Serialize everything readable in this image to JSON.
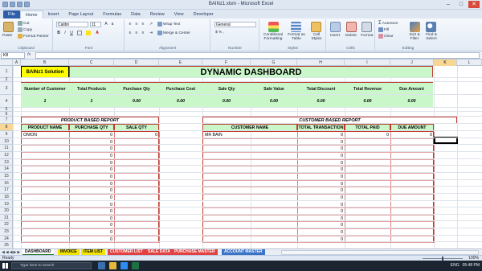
{
  "window": {
    "title": "BAINz1.xlsm  -  Microsoft Excel"
  },
  "tabs": [
    "File",
    "Home",
    "Insert",
    "Page Layout",
    "Formulas",
    "Data",
    "Review",
    "View",
    "Developer"
  ],
  "ribbon": {
    "clipboard": {
      "paste": "Paste",
      "cut": "Cut",
      "copy": "Copy",
      "format_painter": "Format Painter",
      "group": "Clipboard"
    },
    "font": {
      "name": "Calibri",
      "size": "11",
      "group": "Font"
    },
    "alignment": {
      "wrap": "Wrap Text",
      "merge": "Merge & Center",
      "group": "Alignment"
    },
    "number": {
      "format": "General",
      "symbols": "$  %  ,",
      "group": "Number"
    },
    "styles": {
      "cond": "Conditional Formatting",
      "table": "Format as Table",
      "cell": "Cell Styles",
      "group": "Styles"
    },
    "cells": {
      "insert": "Insert",
      "delete": "Delete",
      "format": "Format",
      "group": "Cells"
    },
    "editing": {
      "autosum": "AutoSum",
      "fill": "Fill",
      "clear": "Clear",
      "sort": "Sort & Filter",
      "find": "Find & Select",
      "group": "Editing"
    }
  },
  "formula_bar": {
    "name_box": "K8",
    "fx": "fx",
    "value": ""
  },
  "columns": [
    "A",
    "B",
    "C",
    "D",
    "E",
    "F",
    "G",
    "H",
    "I",
    "J",
    "K",
    "L"
  ],
  "rows": [
    "1",
    "2",
    "3",
    "4",
    "5",
    "6",
    "7",
    "8",
    "9",
    "10",
    "11",
    "12",
    "13",
    "14",
    "15",
    "16",
    "17",
    "18",
    "19",
    "20",
    "21",
    "22",
    "23",
    "24",
    "25"
  ],
  "sheet": {
    "brand": "BAINz1 Solution",
    "title": "DYNAMIC DASHBOARD",
    "kpis": [
      {
        "label": "Number of Customer",
        "value": "1"
      },
      {
        "label": "Total Products",
        "value": "1"
      },
      {
        "label": "Purchase Qty",
        "value": "0.00"
      },
      {
        "label": "Purchase Cost",
        "value": "0.00"
      },
      {
        "label": "Sale Qty",
        "value": "0.00"
      },
      {
        "label": "Sale Value",
        "value": "0.00"
      },
      {
        "label": "Total Discount",
        "value": "0.00"
      },
      {
        "label": "Total Revenue",
        "value": "0.00"
      },
      {
        "label": "Due Amount",
        "value": "0.00"
      }
    ],
    "product_report": {
      "title": "PRODUCT BASED REPORT",
      "headers": [
        "PRODUCT NAME",
        "PURCHASE QTY",
        "SALE QTY"
      ],
      "rows": [
        [
          "ONION",
          "0",
          "0"
        ],
        [
          "",
          "0",
          ""
        ],
        [
          "",
          "0",
          ""
        ],
        [
          "",
          "0",
          ""
        ],
        [
          "",
          "0",
          ""
        ],
        [
          "",
          "0",
          ""
        ],
        [
          "",
          "0",
          ""
        ],
        [
          "",
          "0",
          ""
        ],
        [
          "",
          "0",
          ""
        ],
        [
          "",
          "0",
          ""
        ],
        [
          "",
          "0",
          ""
        ],
        [
          "",
          "0",
          ""
        ],
        [
          "",
          "0",
          ""
        ],
        [
          "",
          "0",
          ""
        ],
        [
          "",
          "0",
          ""
        ],
        [
          "",
          "0",
          ""
        ]
      ]
    },
    "customer_report": {
      "title": "CUSTOMER BASED REPORT",
      "headers": [
        "CUSTOMER NAME",
        "TOTAL TRANSACTION",
        "TOTAL PAID",
        "DUE AMOUNT"
      ],
      "rows": [
        [
          "MR BAIN",
          "0",
          "0",
          "0"
        ],
        [
          "",
          "0",
          "",
          ""
        ],
        [
          "",
          "0",
          "",
          ""
        ],
        [
          "",
          "0",
          "",
          ""
        ],
        [
          "",
          "0",
          "",
          ""
        ],
        [
          "",
          "0",
          "",
          ""
        ],
        [
          "",
          "0",
          "",
          ""
        ],
        [
          "",
          "0",
          "",
          ""
        ],
        [
          "",
          "0",
          "",
          ""
        ],
        [
          "",
          "0",
          "",
          ""
        ],
        [
          "",
          "0",
          "",
          ""
        ],
        [
          "",
          "0",
          "",
          ""
        ],
        [
          "",
          "0",
          "",
          ""
        ],
        [
          "",
          "0",
          "",
          ""
        ],
        [
          "",
          "0",
          "",
          ""
        ],
        [
          "",
          "0",
          "",
          ""
        ]
      ]
    }
  },
  "sheet_tabs": [
    {
      "label": "DASHBOARD",
      "color": "#ffffff"
    },
    {
      "label": "INVOICE",
      "color": "#f2e300"
    },
    {
      "label": "ITEM LIST",
      "color": "#f2e300"
    },
    {
      "label": "CUSTOMER LIST",
      "color": "#e14141"
    },
    {
      "label": "SALE DATA",
      "color": "#e14141"
    },
    {
      "label": "PURCHASE MASTER",
      "color": "#e14141"
    },
    {
      "label": "ACCOUNT MASTER",
      "color": "#3a73c7"
    }
  ],
  "status": {
    "ready": "Ready",
    "zoom": "100%"
  },
  "taskbar": {
    "search": "Type here to search",
    "lang": "ENG",
    "time": "05:48 PM"
  }
}
